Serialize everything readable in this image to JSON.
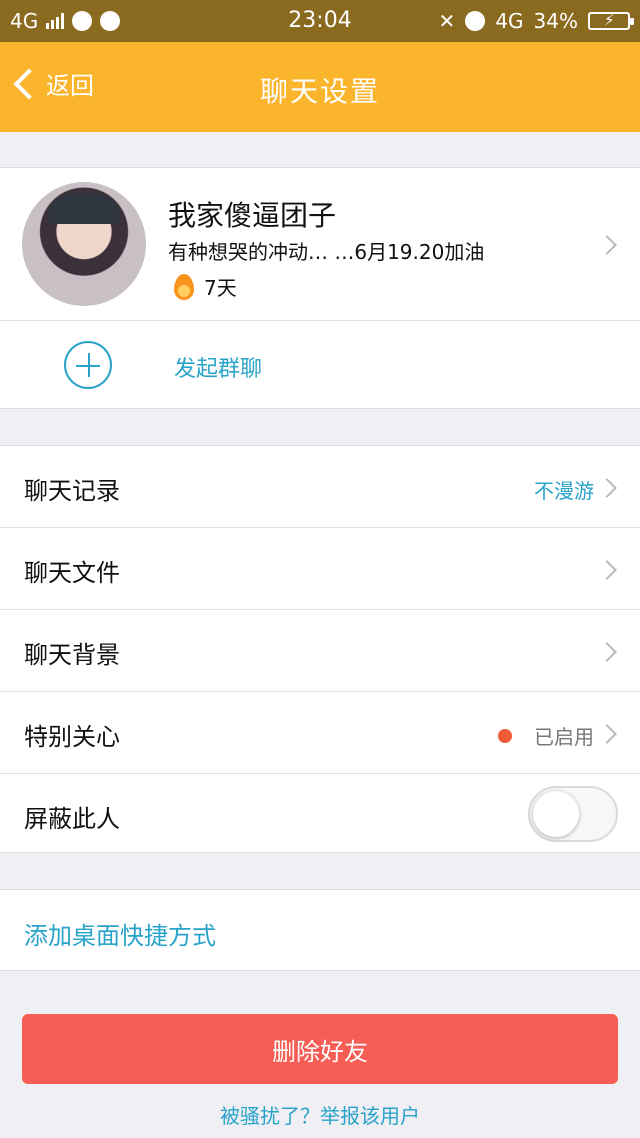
{
  "status_bar": {
    "network": "4G",
    "time": "23:04",
    "network_right": "4G",
    "battery": "34%"
  },
  "nav": {
    "back_label": "返回",
    "title": "聊天设置"
  },
  "profile": {
    "name": "我家傻逼团子",
    "signature": "有种想哭的冲动… …6月19.20加油",
    "streak_days": "7天"
  },
  "group_chat": {
    "label": "发起群聊"
  },
  "settings": {
    "chat_history": {
      "label": "聊天记录",
      "value": "不漫游"
    },
    "chat_files": {
      "label": "聊天文件"
    },
    "chat_background": {
      "label": "聊天背景"
    },
    "special_care": {
      "label": "特别关心",
      "value": "已启用"
    },
    "block_user": {
      "label": "屏蔽此人",
      "enabled": false
    }
  },
  "shortcut": {
    "label": "添加桌面快捷方式"
  },
  "actions": {
    "delete_label": "删除好友",
    "report_label": "被骚扰了？举报该用户"
  },
  "colors": {
    "nav_bg": "#fbb52d",
    "accent_blue": "#29a3c9",
    "danger": "#f65d55",
    "dot": "#f05b37"
  }
}
